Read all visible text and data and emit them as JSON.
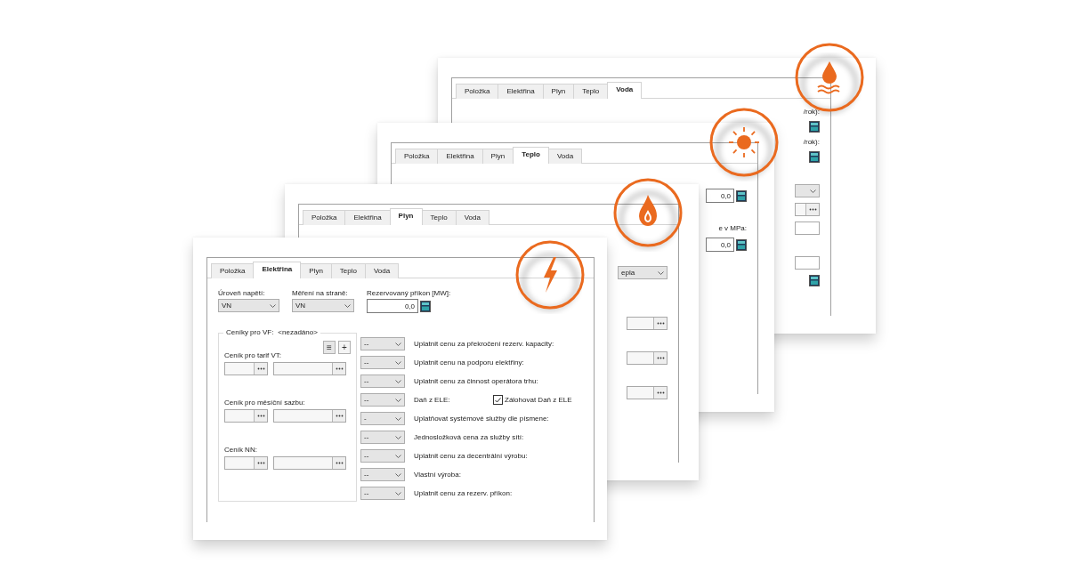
{
  "windows": [
    {
      "kind": "water",
      "tabs": [
        {
          "label": "Položka",
          "selected": false
        },
        {
          "label": "Elektřina",
          "selected": false
        },
        {
          "label": "Plyn",
          "selected": false
        },
        {
          "label": "Teplo",
          "selected": false
        },
        {
          "label": "Voda",
          "selected": true
        }
      ],
      "fragments": [
        {
          "kind": "label",
          "text": "/rok):"
        },
        {
          "kind": "calc"
        },
        {
          "kind": "label",
          "text": "/rok):"
        },
        {
          "kind": "calc"
        },
        {
          "kind": "gap"
        },
        {
          "kind": "dropdown"
        },
        {
          "kind": "browse"
        },
        {
          "kind": "blank"
        },
        {
          "kind": "gap"
        },
        {
          "kind": "blank"
        },
        {
          "kind": "calc"
        }
      ]
    },
    {
      "kind": "sun",
      "tabs": [
        {
          "label": "Položka",
          "selected": false
        },
        {
          "label": "Elektřina",
          "selected": false
        },
        {
          "label": "Plyn",
          "selected": false
        },
        {
          "label": "Teplo",
          "selected": true
        },
        {
          "label": "Voda",
          "selected": false
        }
      ],
      "fragments": [
        {
          "kind": "gap"
        },
        {
          "kind": "number",
          "text": "0,0"
        },
        {
          "kind": "gap"
        },
        {
          "kind": "label",
          "text": "e v MPa:"
        },
        {
          "kind": "number",
          "text": "0,0"
        }
      ]
    },
    {
      "kind": "flame",
      "tabs": [
        {
          "label": "Položka",
          "selected": false
        },
        {
          "label": "Elektřina",
          "selected": false
        },
        {
          "label": "Plyn",
          "selected": true
        },
        {
          "label": "Teplo",
          "selected": false
        },
        {
          "label": "Voda",
          "selected": false
        }
      ],
      "fragments": [
        {
          "kind": "gap"
        },
        {
          "kind": "gap"
        },
        {
          "kind": "dropdown",
          "text": "epla"
        },
        {
          "kind": "gap"
        },
        {
          "kind": "gap"
        },
        {
          "kind": "browse"
        },
        {
          "kind": "gap"
        },
        {
          "kind": "browse"
        },
        {
          "kind": "gap"
        },
        {
          "kind": "browse"
        }
      ]
    },
    {
      "kind": "lightning",
      "tabs": [
        {
          "label": "Položka",
          "selected": false
        },
        {
          "label": "Elektřina",
          "selected": true
        },
        {
          "label": "Plyn",
          "selected": false
        },
        {
          "label": "Teplo",
          "selected": false
        },
        {
          "label": "Voda",
          "selected": false
        }
      ]
    }
  ],
  "form": {
    "voltage_level": {
      "label": "Úroveň napětí:",
      "value": "VN"
    },
    "metering_side": {
      "label": "Měření na straně:",
      "value": "VN"
    },
    "reserved_power": {
      "label": "Rezervovaný příkon [MW]:",
      "value": "0,0"
    },
    "price_lists": {
      "legend": "Ceníky pro VF:",
      "legend_value": "<nezadáno>",
      "menu_button": "≡",
      "add_button": "+",
      "items": [
        {
          "label": "Ceník pro tarif VT:"
        },
        {
          "label": "Ceník pro měsíční sazbu:"
        },
        {
          "label": "Ceník NN:"
        }
      ]
    },
    "options": [
      {
        "value": "--",
        "label": "Uplatnit cenu za překročení rezerv. kapacity:"
      },
      {
        "value": "--",
        "label": "Uplatnit cenu na podporu elektřiny:"
      },
      {
        "value": "--",
        "label": "Uplatnit cenu za činnost operátora trhu:"
      },
      {
        "value": "--",
        "label": "Daň z ELE:",
        "checkbox": {
          "label": "Zálohovat Daň z ELE",
          "checked": true
        }
      },
      {
        "value": "-",
        "label": "Uplatňovat systémové služby dle písmene:"
      },
      {
        "value": "--",
        "label": "Jednosložková cena za služby sítí:"
      },
      {
        "value": "--",
        "label": "Uplatnit cenu za decentrální výrobu:"
      },
      {
        "value": "--",
        "label": "Vlastní výroba:"
      },
      {
        "value": "--",
        "label": "Uplatnit cenu za rezerv. příkon:"
      }
    ]
  }
}
